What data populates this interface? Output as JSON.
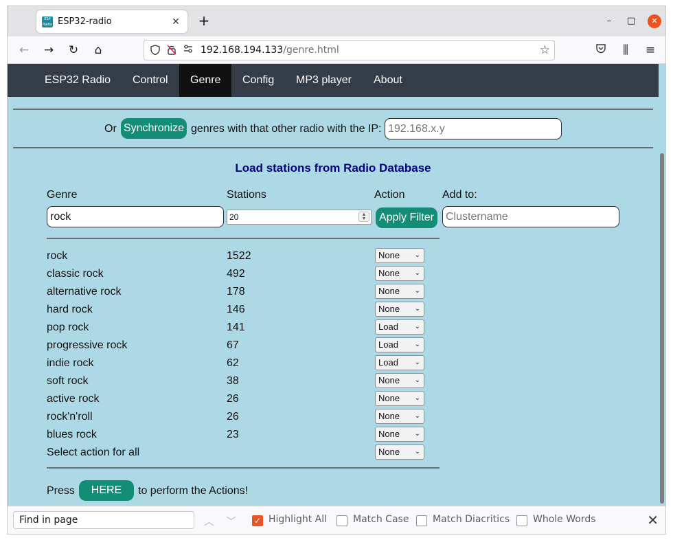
{
  "browser": {
    "tab_title": "ESP32-radio",
    "favicon_text": "ESP Radio",
    "tab_close": "✕",
    "new_tab": "+",
    "url_host": "192.168.194.133",
    "url_path": "/genre.html",
    "window_controls": {
      "minimize": "–",
      "maximize": "□",
      "close": "✕"
    },
    "nav_icons": {
      "back": "←",
      "forward": "→",
      "reload": "↻",
      "home": "⌂",
      "star": "☆",
      "pocket": "♡",
      "library": "⫼",
      "menu": "≡"
    }
  },
  "site_nav": {
    "items": [
      {
        "label": "ESP32 Radio",
        "active": false
      },
      {
        "label": "Control",
        "active": false
      },
      {
        "label": "Genre",
        "active": true
      },
      {
        "label": "Config",
        "active": false
      },
      {
        "label": "MP3 player",
        "active": false
      },
      {
        "label": "About",
        "active": false
      }
    ]
  },
  "sync": {
    "prefix": "Or",
    "button_label": "Synchronize",
    "suffix": "genres with that other radio with the IP:",
    "ip_placeholder": "192.168.x.y"
  },
  "load": {
    "title": "Load stations from Radio Database",
    "headers": {
      "genre": "Genre",
      "stations": "Stations",
      "action": "Action",
      "add_to": "Add to:"
    },
    "genre_value": "rock",
    "stations_value": "20",
    "apply_label": "Apply Filter",
    "cluster_placeholder": "Clustername"
  },
  "genres": [
    {
      "name": "rock",
      "count": "1522",
      "action": "None"
    },
    {
      "name": "classic rock",
      "count": "492",
      "action": "None"
    },
    {
      "name": "alternative rock",
      "count": "178",
      "action": "None"
    },
    {
      "name": "hard rock",
      "count": "146",
      "action": "None"
    },
    {
      "name": "pop rock",
      "count": "141",
      "action": "Load"
    },
    {
      "name": "progressive rock",
      "count": "67",
      "action": "Load"
    },
    {
      "name": "indie rock",
      "count": "62",
      "action": "Load"
    },
    {
      "name": "soft rock",
      "count": "38",
      "action": "None"
    },
    {
      "name": "active rock",
      "count": "26",
      "action": "None"
    },
    {
      "name": "rock'n'roll",
      "count": "26",
      "action": "None"
    },
    {
      "name": "blues rock",
      "count": "23",
      "action": "None"
    }
  ],
  "select_all": {
    "label": "Select action for all",
    "action": "None"
  },
  "footer": {
    "prefix": "Press",
    "button_label": "HERE",
    "suffix": "to perform the Actions!"
  },
  "findbar": {
    "placeholder": "Find in page",
    "up": "︿",
    "down": "﹀",
    "highlight_all": "Highlight All",
    "highlight_all_checked": true,
    "match_case": "Match Case",
    "match_diacritics": "Match Diacritics",
    "whole_words": "Whole Words",
    "close": "✕"
  }
}
